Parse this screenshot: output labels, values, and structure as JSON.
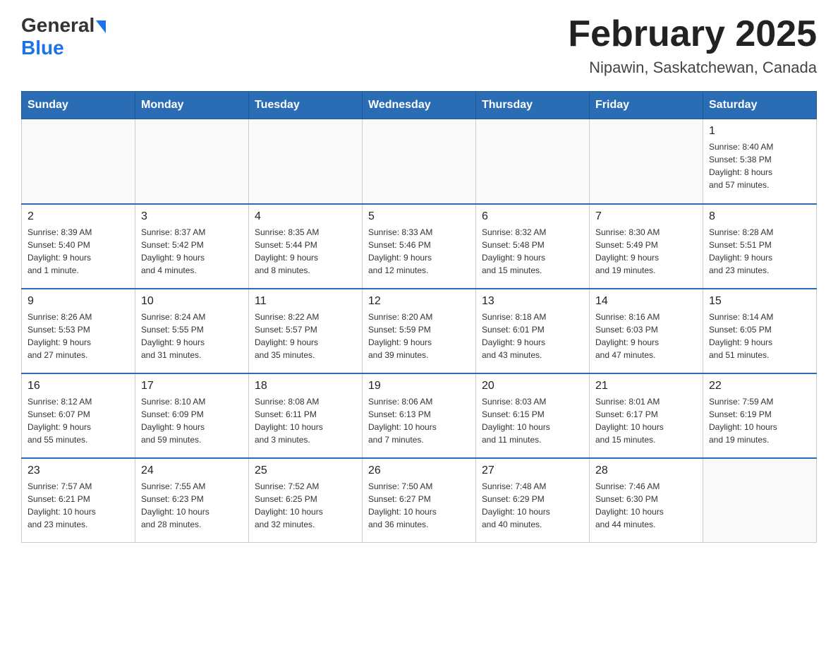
{
  "header": {
    "logo_general": "General",
    "logo_blue": "Blue",
    "title": "February 2025",
    "subtitle": "Nipawin, Saskatchewan, Canada"
  },
  "weekdays": [
    "Sunday",
    "Monday",
    "Tuesday",
    "Wednesday",
    "Thursday",
    "Friday",
    "Saturday"
  ],
  "weeks": [
    [
      {
        "day": "",
        "info": ""
      },
      {
        "day": "",
        "info": ""
      },
      {
        "day": "",
        "info": ""
      },
      {
        "day": "",
        "info": ""
      },
      {
        "day": "",
        "info": ""
      },
      {
        "day": "",
        "info": ""
      },
      {
        "day": "1",
        "info": "Sunrise: 8:40 AM\nSunset: 5:38 PM\nDaylight: 8 hours\nand 57 minutes."
      }
    ],
    [
      {
        "day": "2",
        "info": "Sunrise: 8:39 AM\nSunset: 5:40 PM\nDaylight: 9 hours\nand 1 minute."
      },
      {
        "day": "3",
        "info": "Sunrise: 8:37 AM\nSunset: 5:42 PM\nDaylight: 9 hours\nand 4 minutes."
      },
      {
        "day": "4",
        "info": "Sunrise: 8:35 AM\nSunset: 5:44 PM\nDaylight: 9 hours\nand 8 minutes."
      },
      {
        "day": "5",
        "info": "Sunrise: 8:33 AM\nSunset: 5:46 PM\nDaylight: 9 hours\nand 12 minutes."
      },
      {
        "day": "6",
        "info": "Sunrise: 8:32 AM\nSunset: 5:48 PM\nDaylight: 9 hours\nand 15 minutes."
      },
      {
        "day": "7",
        "info": "Sunrise: 8:30 AM\nSunset: 5:49 PM\nDaylight: 9 hours\nand 19 minutes."
      },
      {
        "day": "8",
        "info": "Sunrise: 8:28 AM\nSunset: 5:51 PM\nDaylight: 9 hours\nand 23 minutes."
      }
    ],
    [
      {
        "day": "9",
        "info": "Sunrise: 8:26 AM\nSunset: 5:53 PM\nDaylight: 9 hours\nand 27 minutes."
      },
      {
        "day": "10",
        "info": "Sunrise: 8:24 AM\nSunset: 5:55 PM\nDaylight: 9 hours\nand 31 minutes."
      },
      {
        "day": "11",
        "info": "Sunrise: 8:22 AM\nSunset: 5:57 PM\nDaylight: 9 hours\nand 35 minutes."
      },
      {
        "day": "12",
        "info": "Sunrise: 8:20 AM\nSunset: 5:59 PM\nDaylight: 9 hours\nand 39 minutes."
      },
      {
        "day": "13",
        "info": "Sunrise: 8:18 AM\nSunset: 6:01 PM\nDaylight: 9 hours\nand 43 minutes."
      },
      {
        "day": "14",
        "info": "Sunrise: 8:16 AM\nSunset: 6:03 PM\nDaylight: 9 hours\nand 47 minutes."
      },
      {
        "day": "15",
        "info": "Sunrise: 8:14 AM\nSunset: 6:05 PM\nDaylight: 9 hours\nand 51 minutes."
      }
    ],
    [
      {
        "day": "16",
        "info": "Sunrise: 8:12 AM\nSunset: 6:07 PM\nDaylight: 9 hours\nand 55 minutes."
      },
      {
        "day": "17",
        "info": "Sunrise: 8:10 AM\nSunset: 6:09 PM\nDaylight: 9 hours\nand 59 minutes."
      },
      {
        "day": "18",
        "info": "Sunrise: 8:08 AM\nSunset: 6:11 PM\nDaylight: 10 hours\nand 3 minutes."
      },
      {
        "day": "19",
        "info": "Sunrise: 8:06 AM\nSunset: 6:13 PM\nDaylight: 10 hours\nand 7 minutes."
      },
      {
        "day": "20",
        "info": "Sunrise: 8:03 AM\nSunset: 6:15 PM\nDaylight: 10 hours\nand 11 minutes."
      },
      {
        "day": "21",
        "info": "Sunrise: 8:01 AM\nSunset: 6:17 PM\nDaylight: 10 hours\nand 15 minutes."
      },
      {
        "day": "22",
        "info": "Sunrise: 7:59 AM\nSunset: 6:19 PM\nDaylight: 10 hours\nand 19 minutes."
      }
    ],
    [
      {
        "day": "23",
        "info": "Sunrise: 7:57 AM\nSunset: 6:21 PM\nDaylight: 10 hours\nand 23 minutes."
      },
      {
        "day": "24",
        "info": "Sunrise: 7:55 AM\nSunset: 6:23 PM\nDaylight: 10 hours\nand 28 minutes."
      },
      {
        "day": "25",
        "info": "Sunrise: 7:52 AM\nSunset: 6:25 PM\nDaylight: 10 hours\nand 32 minutes."
      },
      {
        "day": "26",
        "info": "Sunrise: 7:50 AM\nSunset: 6:27 PM\nDaylight: 10 hours\nand 36 minutes."
      },
      {
        "day": "27",
        "info": "Sunrise: 7:48 AM\nSunset: 6:29 PM\nDaylight: 10 hours\nand 40 minutes."
      },
      {
        "day": "28",
        "info": "Sunrise: 7:46 AM\nSunset: 6:30 PM\nDaylight: 10 hours\nand 44 minutes."
      },
      {
        "day": "",
        "info": ""
      }
    ]
  ]
}
